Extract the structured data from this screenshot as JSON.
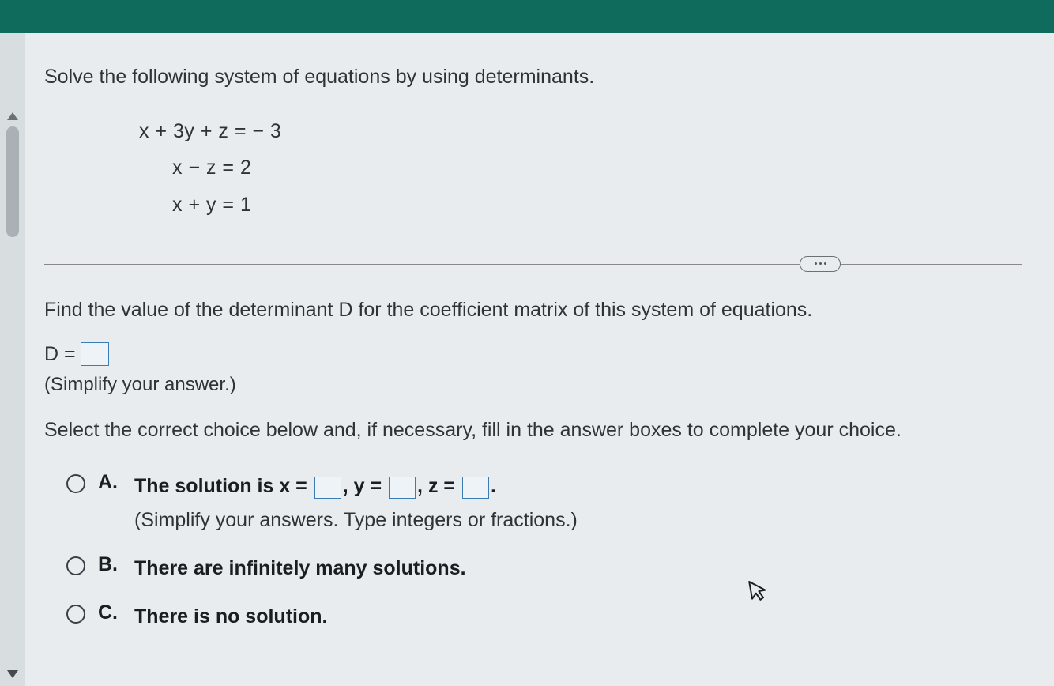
{
  "question": {
    "instruction": "Solve the following system of equations by using determinants.",
    "equations": {
      "eq1": "x + 3y + z = − 3",
      "eq2": "x − z = 2",
      "eq3": "x + y = 1"
    }
  },
  "part1": {
    "prompt": "Find the value of the determinant D for the coefficient matrix of this system of equations.",
    "d_label": "D =",
    "hint": "(Simplify your answer.)"
  },
  "part2": {
    "prompt": "Select the correct choice below and, if necessary, fill in the answer boxes to complete your choice.",
    "choices": {
      "a": {
        "label": "A.",
        "text_prefix": "The solution is x =",
        "y_sep": ", y =",
        "z_sep": ", z =",
        "period": ".",
        "sub": "(Simplify your answers. Type integers or fractions.)"
      },
      "b": {
        "label": "B.",
        "text": "There are infinitely many solutions."
      },
      "c": {
        "label": "C.",
        "text": "There is no solution."
      }
    }
  }
}
